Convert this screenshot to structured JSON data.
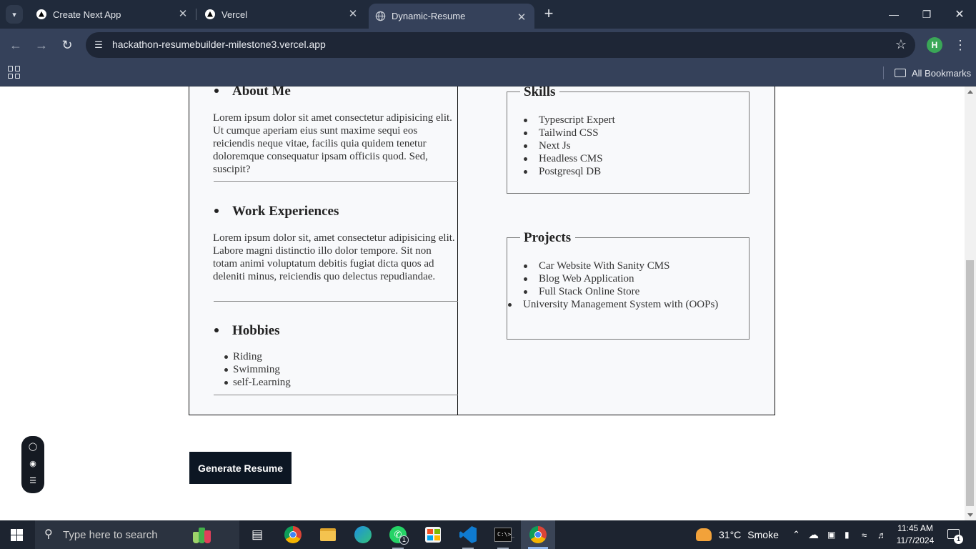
{
  "browser": {
    "tabs": [
      {
        "title": "Create Next App",
        "icon": "triangle-logo-icon"
      },
      {
        "title": "Vercel",
        "icon": "triangle-logo-icon"
      },
      {
        "title": "Dynamic-Resume",
        "icon": "globe-icon",
        "active": true
      }
    ],
    "url": "hackathon-resumebuilder-milestone3.vercel.app",
    "profile_initial": "H",
    "bookmarks_label": "All Bookmarks"
  },
  "resume": {
    "about": {
      "heading": "About Me",
      "text": "Lorem ipsum dolor sit amet consectetur adipisicing elit. Ut cumque aperiam eius sunt maxime sequi eos reiciendis neque vitae, facilis quia quidem tenetur doloremque consequatur ipsam officiis quod. Sed, suscipit?"
    },
    "work": {
      "heading": "Work Experiences",
      "text": "Lorem ipsum dolor sit, amet consectetur adipisicing elit. Labore magni distinctio illo dolor tempore. Sit non totam animi voluptatum debitis fugiat dicta quos ad deleniti minus, reiciendis quo delectus repudiandae."
    },
    "hobbies": {
      "heading": "Hobbies",
      "items": [
        "Riding",
        "Swimming",
        "self-Learning"
      ]
    },
    "skills": {
      "legend": "Skills",
      "items": [
        "Typescript Expert",
        "Tailwind CSS",
        "Next Js",
        "Headless CMS",
        "Postgresql DB"
      ]
    },
    "projects": {
      "legend": "Projects",
      "items": [
        "Car Website With Sanity CMS",
        "Blog Web Application",
        "Full Stack Online Store",
        "University Management System with (OOPs)"
      ]
    }
  },
  "generate_button": "Generate Resume",
  "taskbar": {
    "search_placeholder": "Type here to search",
    "weather_temp": "31°C",
    "weather_text": "Smoke",
    "time": "11:45 AM",
    "date": "11/7/2024",
    "whatsapp_badge": "1",
    "notification_badge": "1"
  },
  "colors": {
    "chrome_dark": "#202a3b",
    "chrome_toolbar": "#35415a",
    "button_bg": "#0c1623",
    "resume_bg": "#f8f9fb"
  }
}
